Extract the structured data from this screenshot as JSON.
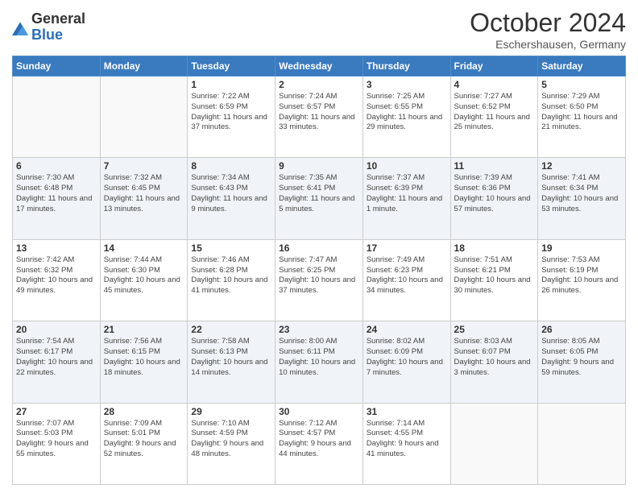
{
  "logo": {
    "general": "General",
    "blue": "Blue"
  },
  "header": {
    "month": "October 2024",
    "location": "Eschershausen, Germany"
  },
  "days_of_week": [
    "Sunday",
    "Monday",
    "Tuesday",
    "Wednesday",
    "Thursday",
    "Friday",
    "Saturday"
  ],
  "weeks": [
    [
      {
        "day": "",
        "info": ""
      },
      {
        "day": "",
        "info": ""
      },
      {
        "day": "1",
        "info": "Sunrise: 7:22 AM\nSunset: 6:59 PM\nDaylight: 11 hours and 37 minutes."
      },
      {
        "day": "2",
        "info": "Sunrise: 7:24 AM\nSunset: 6:57 PM\nDaylight: 11 hours and 33 minutes."
      },
      {
        "day": "3",
        "info": "Sunrise: 7:25 AM\nSunset: 6:55 PM\nDaylight: 11 hours and 29 minutes."
      },
      {
        "day": "4",
        "info": "Sunrise: 7:27 AM\nSunset: 6:52 PM\nDaylight: 11 hours and 25 minutes."
      },
      {
        "day": "5",
        "info": "Sunrise: 7:29 AM\nSunset: 6:50 PM\nDaylight: 11 hours and 21 minutes."
      }
    ],
    [
      {
        "day": "6",
        "info": "Sunrise: 7:30 AM\nSunset: 6:48 PM\nDaylight: 11 hours and 17 minutes."
      },
      {
        "day": "7",
        "info": "Sunrise: 7:32 AM\nSunset: 6:45 PM\nDaylight: 11 hours and 13 minutes."
      },
      {
        "day": "8",
        "info": "Sunrise: 7:34 AM\nSunset: 6:43 PM\nDaylight: 11 hours and 9 minutes."
      },
      {
        "day": "9",
        "info": "Sunrise: 7:35 AM\nSunset: 6:41 PM\nDaylight: 11 hours and 5 minutes."
      },
      {
        "day": "10",
        "info": "Sunrise: 7:37 AM\nSunset: 6:39 PM\nDaylight: 11 hours and 1 minute."
      },
      {
        "day": "11",
        "info": "Sunrise: 7:39 AM\nSunset: 6:36 PM\nDaylight: 10 hours and 57 minutes."
      },
      {
        "day": "12",
        "info": "Sunrise: 7:41 AM\nSunset: 6:34 PM\nDaylight: 10 hours and 53 minutes."
      }
    ],
    [
      {
        "day": "13",
        "info": "Sunrise: 7:42 AM\nSunset: 6:32 PM\nDaylight: 10 hours and 49 minutes."
      },
      {
        "day": "14",
        "info": "Sunrise: 7:44 AM\nSunset: 6:30 PM\nDaylight: 10 hours and 45 minutes."
      },
      {
        "day": "15",
        "info": "Sunrise: 7:46 AM\nSunset: 6:28 PM\nDaylight: 10 hours and 41 minutes."
      },
      {
        "day": "16",
        "info": "Sunrise: 7:47 AM\nSunset: 6:25 PM\nDaylight: 10 hours and 37 minutes."
      },
      {
        "day": "17",
        "info": "Sunrise: 7:49 AM\nSunset: 6:23 PM\nDaylight: 10 hours and 34 minutes."
      },
      {
        "day": "18",
        "info": "Sunrise: 7:51 AM\nSunset: 6:21 PM\nDaylight: 10 hours and 30 minutes."
      },
      {
        "day": "19",
        "info": "Sunrise: 7:53 AM\nSunset: 6:19 PM\nDaylight: 10 hours and 26 minutes."
      }
    ],
    [
      {
        "day": "20",
        "info": "Sunrise: 7:54 AM\nSunset: 6:17 PM\nDaylight: 10 hours and 22 minutes."
      },
      {
        "day": "21",
        "info": "Sunrise: 7:56 AM\nSunset: 6:15 PM\nDaylight: 10 hours and 18 minutes."
      },
      {
        "day": "22",
        "info": "Sunrise: 7:58 AM\nSunset: 6:13 PM\nDaylight: 10 hours and 14 minutes."
      },
      {
        "day": "23",
        "info": "Sunrise: 8:00 AM\nSunset: 6:11 PM\nDaylight: 10 hours and 10 minutes."
      },
      {
        "day": "24",
        "info": "Sunrise: 8:02 AM\nSunset: 6:09 PM\nDaylight: 10 hours and 7 minutes."
      },
      {
        "day": "25",
        "info": "Sunrise: 8:03 AM\nSunset: 6:07 PM\nDaylight: 10 hours and 3 minutes."
      },
      {
        "day": "26",
        "info": "Sunrise: 8:05 AM\nSunset: 6:05 PM\nDaylight: 9 hours and 59 minutes."
      }
    ],
    [
      {
        "day": "27",
        "info": "Sunrise: 7:07 AM\nSunset: 5:03 PM\nDaylight: 9 hours and 55 minutes."
      },
      {
        "day": "28",
        "info": "Sunrise: 7:09 AM\nSunset: 5:01 PM\nDaylight: 9 hours and 52 minutes."
      },
      {
        "day": "29",
        "info": "Sunrise: 7:10 AM\nSunset: 4:59 PM\nDaylight: 9 hours and 48 minutes."
      },
      {
        "day": "30",
        "info": "Sunrise: 7:12 AM\nSunset: 4:57 PM\nDaylight: 9 hours and 44 minutes."
      },
      {
        "day": "31",
        "info": "Sunrise: 7:14 AM\nSunset: 4:55 PM\nDaylight: 9 hours and 41 minutes."
      },
      {
        "day": "",
        "info": ""
      },
      {
        "day": "",
        "info": ""
      }
    ]
  ]
}
